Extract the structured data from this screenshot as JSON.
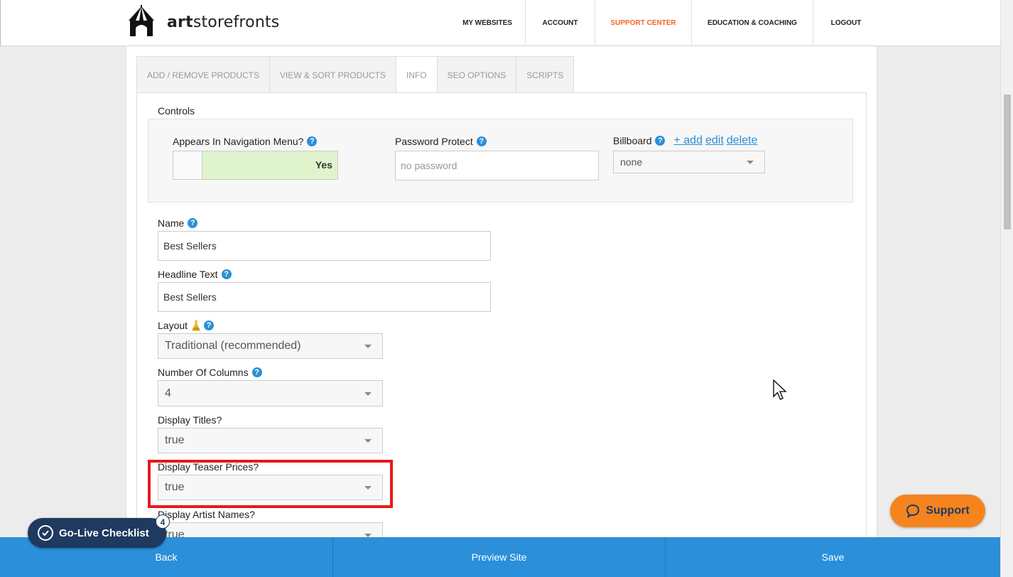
{
  "brand": {
    "logo_text_bold": "art",
    "logo_text_rest": "storefronts"
  },
  "nav": [
    {
      "label": "MY WEBSITES",
      "active": false
    },
    {
      "label": "ACCOUNT",
      "active": false
    },
    {
      "label": "SUPPORT CENTER",
      "active": true
    },
    {
      "label": "EDUCATION & COACHING",
      "active": false
    },
    {
      "label": "LOGOUT",
      "active": false
    }
  ],
  "tabs": [
    {
      "label": "ADD / REMOVE PRODUCTS"
    },
    {
      "label": "VIEW & SORT PRODUCTS"
    },
    {
      "label": "INFO",
      "active": true
    },
    {
      "label": "SEO OPTIONS"
    },
    {
      "label": "SCRIPTS"
    }
  ],
  "controls": {
    "title": "Controls",
    "nav_menu_label": "Appears In Navigation Menu?",
    "nav_menu_value": "Yes",
    "password_label": "Password Protect",
    "password_placeholder": "no password",
    "billboard_label": "Billboard",
    "billboard_add": "+ add",
    "billboard_edit": "edit",
    "billboard_delete": "delete",
    "billboard_value": "none"
  },
  "form": {
    "name_label": "Name",
    "name_value": "Best Sellers",
    "headline_label": "Headline Text",
    "headline_value": "Best Sellers",
    "layout_label": "Layout",
    "layout_value": "Traditional (recommended)",
    "columns_label": "Number Of Columns",
    "columns_value": "4",
    "titles_label": "Display Titles?",
    "titles_value": "true",
    "teaser_label": "Display Teaser Prices?",
    "teaser_value": "true",
    "artist_label": "Display Artist Names?",
    "artist_value": "true"
  },
  "bottom_bar": {
    "back": "Back",
    "preview": "Preview Site",
    "save": "Save"
  },
  "checklist": {
    "label": "Go-Live Checklist",
    "count": "4"
  },
  "support": {
    "label": "Support"
  },
  "colors": {
    "accent": "#f06722",
    "primary_blue": "#2b8fd9",
    "support_orange": "#f5841f",
    "highlight_red": "#e8191a"
  }
}
